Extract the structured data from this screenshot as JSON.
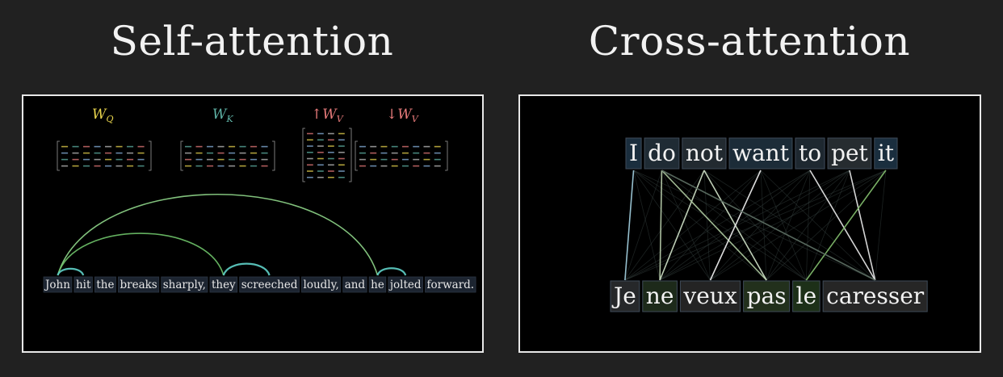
{
  "titles": {
    "left": "Self-attention",
    "right": "Cross-attention"
  },
  "self_attention": {
    "matrices": [
      {
        "label": "W",
        "subscript": "Q",
        "prefix": "",
        "color": "#e8d44d"
      },
      {
        "label": "W",
        "subscript": "K",
        "prefix": "",
        "color": "#5fb3a6"
      },
      {
        "label": "W",
        "subscript": "V",
        "prefix": "↑",
        "color": "#e87b7b"
      },
      {
        "label": "W",
        "subscript": "V",
        "prefix": "↓",
        "color": "#e87b7b"
      }
    ],
    "tokens": [
      "John",
      "hit",
      "the",
      "breaks",
      "sharply,",
      "they",
      "screeched",
      "loudly,",
      "and",
      "he",
      "jolted",
      "forward."
    ],
    "arcs": [
      {
        "from": 0,
        "to": 9,
        "color": "#8fd68a"
      },
      {
        "from": 0,
        "to": 5,
        "color": "#6fc46a"
      },
      {
        "from": 0,
        "to": 1,
        "color": "#5fd1c9"
      },
      {
        "from": 5,
        "to": 6,
        "color": "#5fd1c9"
      },
      {
        "from": 9,
        "to": 10,
        "color": "#5fd1c9"
      }
    ]
  },
  "cross_attention": {
    "source_tokens": [
      "I",
      "do",
      "not",
      "want",
      "to",
      "pet",
      "it"
    ],
    "target_tokens": [
      "Je",
      "ne",
      "veux",
      "pas",
      "le",
      "caresser"
    ],
    "strong_links": [
      {
        "src": 0,
        "tgt": 0,
        "color": "#9ec9d9"
      },
      {
        "src": 1,
        "tgt": 1,
        "color": "#b5c9a8"
      },
      {
        "src": 2,
        "tgt": 1,
        "color": "#c8d9c0"
      },
      {
        "src": 1,
        "tgt": 3,
        "color": "#a8c39a"
      },
      {
        "src": 2,
        "tgt": 3,
        "color": "#c8d9c0"
      },
      {
        "src": 3,
        "tgt": 2,
        "color": "#e8e8e8"
      },
      {
        "src": 4,
        "tgt": 5,
        "color": "#e0e0e0"
      },
      {
        "src": 5,
        "tgt": 5,
        "color": "#e0e0e0"
      },
      {
        "src": 6,
        "tgt": 4,
        "color": "#7fb86a"
      },
      {
        "src": 1,
        "tgt": 5,
        "color": "#5a6b60"
      }
    ]
  }
}
